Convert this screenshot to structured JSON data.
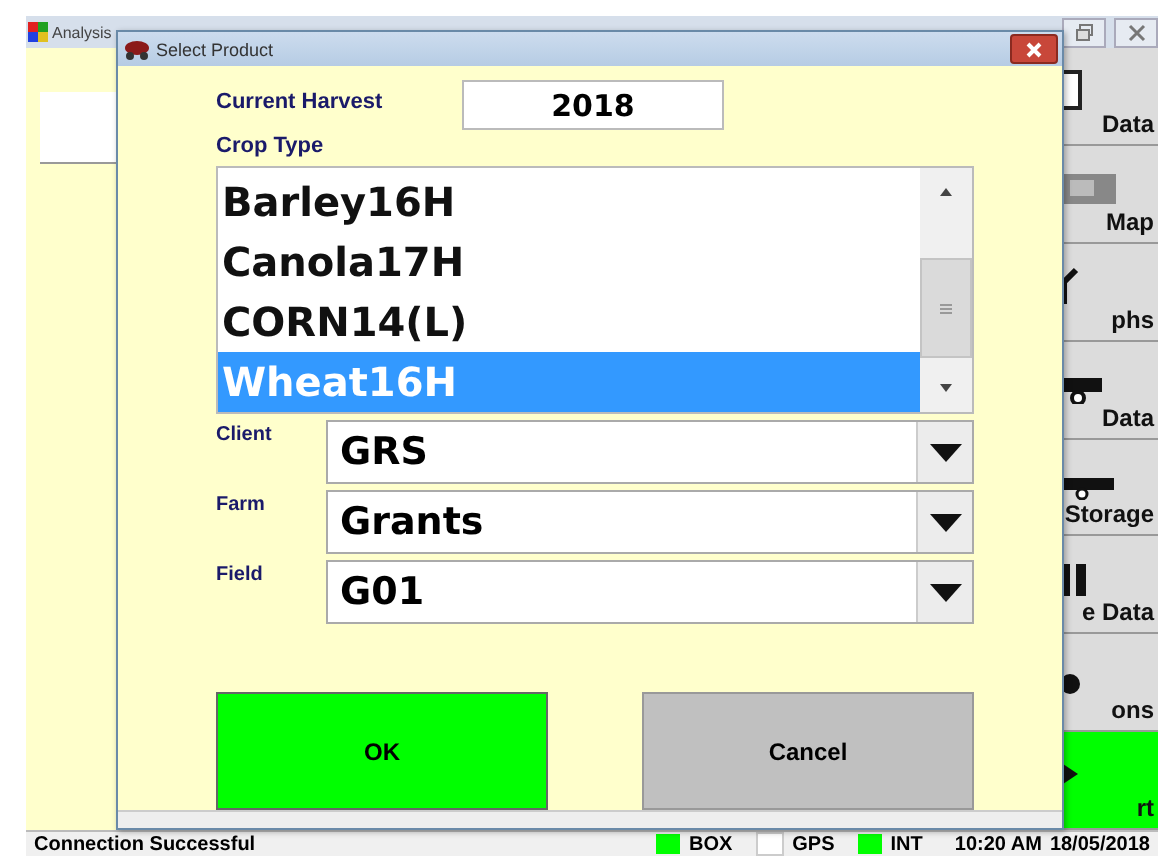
{
  "app_window": {
    "title": "Analysis"
  },
  "sidebar": {
    "items": [
      {
        "kind": "document",
        "label": "Data",
        "highlighted": false
      },
      {
        "kind": "map",
        "label": "Map",
        "highlighted": false
      },
      {
        "kind": "graph",
        "label": "phs",
        "highlighted": false
      },
      {
        "kind": "combine",
        "label": "Data",
        "highlighted": false
      },
      {
        "kind": "truck",
        "label": "Storage",
        "highlighted": false
      },
      {
        "kind": "silo",
        "label": "e Data",
        "highlighted": false
      },
      {
        "kind": "gear",
        "label": "ons",
        "highlighted": false
      },
      {
        "kind": "arrow",
        "label": "rt",
        "highlighted": true
      }
    ]
  },
  "status_bar": {
    "message": "Connection Successful",
    "indicators": [
      {
        "label": "BOX",
        "on": true
      },
      {
        "label": "GPS",
        "on": false
      },
      {
        "label": "INT",
        "on": true
      }
    ],
    "time": "10:20 AM",
    "date": "18/05/2018"
  },
  "dialog": {
    "title": "Select Product",
    "current_harvest": {
      "label": "Current Harvest",
      "value": "2018"
    },
    "crop_type": {
      "label": "Crop Type",
      "items": [
        {
          "label": "Barley16H",
          "selected": false
        },
        {
          "label": "Canola17H",
          "selected": false
        },
        {
          "label": "CORN14(L)",
          "selected": false
        },
        {
          "label": "Wheat16H",
          "selected": true
        }
      ]
    },
    "dropdowns": [
      {
        "label": "Client",
        "value": "GRS"
      },
      {
        "label": "Farm",
        "value": "Grants"
      },
      {
        "label": "Field",
        "value": "G01"
      }
    ],
    "buttons": [
      {
        "label": "OK",
        "kind": "primary"
      },
      {
        "label": "Cancel",
        "kind": "secondary"
      }
    ]
  }
}
